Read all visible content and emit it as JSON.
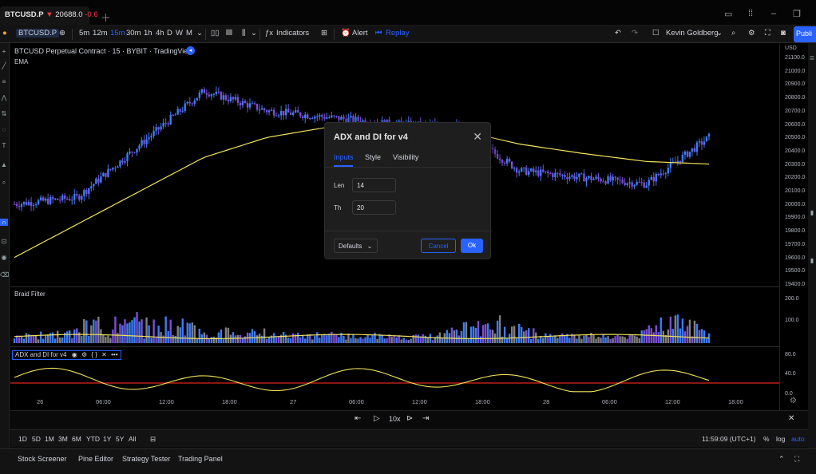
{
  "tab": {
    "symbol": "BTCUSD.P",
    "arrow": "▼",
    "price": "20688.0",
    "change": "-0.6"
  },
  "toolbar": {
    "symbol": "BTCUSD.P",
    "intervals": [
      "5m",
      "12m",
      "15m",
      "30m",
      "1h",
      "4h",
      "D",
      "W",
      "M"
    ],
    "active_interval": "15m",
    "indicators_label": "Indicators",
    "alert_label": "Alert",
    "replay_label": "Replay",
    "user": "Kevin Goldberg",
    "publish_label": "Publi"
  },
  "chart": {
    "title": "BTCUSD Perpetual Contract · 15 · BYBIT · TradingView",
    "ema_label": "EMA",
    "currency": "USD",
    "price_labels": [
      "21100.0",
      "21000.0",
      "20900.0",
      "20800.0",
      "20700.0",
      "20600.0",
      "20500.0",
      "20400.0",
      "20300.0",
      "20200.0",
      "20100.0",
      "20000.0",
      "19900.0",
      "19800.0",
      "19700.0",
      "19600.0",
      "19500.0",
      "19400.0"
    ],
    "braid_label": "Braid Filter",
    "braid_labels": [
      "200.0",
      "100.0"
    ],
    "adx_label": "ADX and DI for v4",
    "adx_labels": [
      "80.0",
      "40.0",
      "0.0"
    ],
    "time_labels": [
      "26",
      "06:00",
      "12:00",
      "18:00",
      "27",
      "06:00",
      "12:00",
      "18:00",
      "28",
      "06:00",
      "12:00",
      "18:00"
    ]
  },
  "chart_data": {
    "type": "line",
    "title": "BTCUSD Perpetual Contract · 15 · BYBIT",
    "ylim": [
      19400,
      21100
    ],
    "x": [
      0,
      6,
      12,
      18,
      24,
      30,
      36,
      42,
      48,
      54,
      60,
      66
    ],
    "series": [
      {
        "name": "price",
        "values": [
          20000,
          20050,
          20450,
          20850,
          20700,
          20650,
          20600,
          20580,
          20250,
          20200,
          20150,
          20500
        ]
      },
      {
        "name": "EMA",
        "values": [
          19600,
          19850,
          20100,
          20350,
          20500,
          20580,
          20580,
          20560,
          20450,
          20380,
          20320,
          20300
        ]
      }
    ]
  },
  "replay": {
    "speed": "10x"
  },
  "ranges": [
    "1D",
    "5D",
    "1M",
    "3M",
    "6M",
    "YTD",
    "1Y",
    "5Y",
    "All"
  ],
  "status": {
    "time": "11:59:09 (UTC+1)",
    "pct": "%",
    "log": "log",
    "auto": "auto"
  },
  "footer": {
    "tabs": [
      "Stock Screener",
      "Pine Editor",
      "Strategy Tester",
      "Trading Panel"
    ]
  },
  "dialog": {
    "title": "ADX and DI for v4",
    "tabs": [
      "Inputs",
      "Style",
      "Visibility"
    ],
    "active_tab": "Inputs",
    "len_label": "Len",
    "len_value": "14",
    "th_label": "Th",
    "th_value": "20",
    "defaults_label": "Defaults",
    "cancel_label": "Cancel",
    "ok_label": "Ok"
  },
  "colors": {
    "accent": "#2962ff",
    "ema": "#f2e35b",
    "bull": "#3d7cf5",
    "bear": "#7b4fd6",
    "threshold": "#e0241a"
  }
}
